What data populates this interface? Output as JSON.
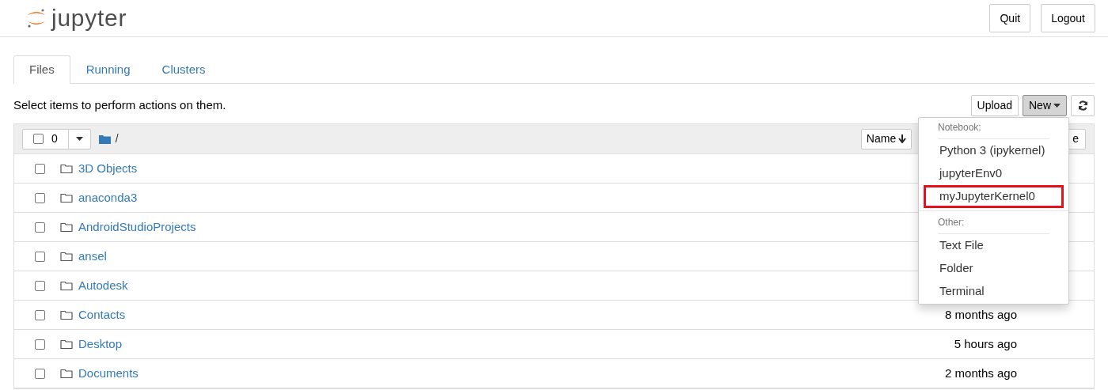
{
  "header": {
    "logo_text": "jupyter",
    "buttons": [
      "Quit",
      "Logout"
    ]
  },
  "tabs": [
    {
      "label": "Files",
      "selected": true
    },
    {
      "label": "Running",
      "selected": false
    },
    {
      "label": "Clusters",
      "selected": false
    }
  ],
  "toolbar": {
    "hint": "Select items to perform actions on them.",
    "upload": "Upload",
    "new": "New",
    "new_open": true
  },
  "list_header": {
    "selected_count": "0",
    "checked": false,
    "path": "/",
    "sort_button": "Name",
    "column_3": "e"
  },
  "rows": [
    {
      "name": "3D Objects",
      "checked": false,
      "modified": ""
    },
    {
      "name": "anaconda3",
      "checked": false,
      "modified": ""
    },
    {
      "name": "AndroidStudioProjects",
      "checked": false,
      "modified": ""
    },
    {
      "name": "ansel",
      "checked": false,
      "modified": ""
    },
    {
      "name": "Autodesk",
      "checked": false,
      "modified": ""
    },
    {
      "name": "Contacts",
      "checked": false,
      "modified": "8 months ago"
    },
    {
      "name": "Desktop",
      "checked": false,
      "modified": "5 hours ago"
    },
    {
      "name": "Documents",
      "checked": false,
      "modified": "2 months ago"
    }
  ],
  "new_menu": [
    {
      "kind": "header",
      "label": "Notebook:"
    },
    {
      "kind": "item",
      "label": "Python 3 (ipykernel)",
      "highlighted": false
    },
    {
      "kind": "item",
      "label": "jupyterEnv0",
      "highlighted": false
    },
    {
      "kind": "item",
      "label": "myJupyterKernel0",
      "highlighted": true
    },
    {
      "kind": "divider"
    },
    {
      "kind": "header",
      "label": "Other:"
    },
    {
      "kind": "item",
      "label": "Text File",
      "highlighted": false
    },
    {
      "kind": "item",
      "label": "Folder",
      "highlighted": false
    },
    {
      "kind": "item",
      "label": "Terminal",
      "highlighted": false
    }
  ]
}
